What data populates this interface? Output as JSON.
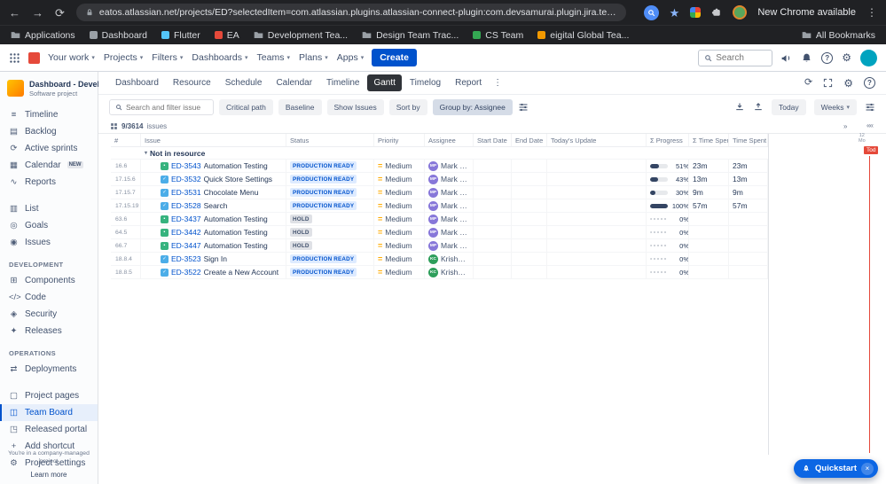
{
  "browser": {
    "url": "eatos.atlassian.net/projects/ED?selectedItem=com.atlassian.plugins.atlassian-connect-plugin:com.devsamurai.plugin.jira.team-boar...",
    "update_notice": "New Chrome available"
  },
  "bookmarks_bar": {
    "items": [
      {
        "label": "Applications",
        "icon": "folder"
      },
      {
        "label": "Dashboard",
        "icon": "favicon",
        "color": "#9aa0a6"
      },
      {
        "label": "Flutter",
        "icon": "favicon",
        "color": "#54c5f8"
      },
      {
        "label": "EA",
        "icon": "favicon",
        "color": "#e5493a"
      },
      {
        "label": "Development Tea...",
        "icon": "folder"
      },
      {
        "label": "Design Team Trac...",
        "icon": "folder"
      },
      {
        "label": "CS Team",
        "icon": "favicon",
        "color": "#34a853"
      },
      {
        "label": "eigital Global Tea...",
        "icon": "favicon",
        "color": "#f29900"
      }
    ],
    "all_bookmarks_label": "All Bookmarks"
  },
  "jira_nav": {
    "menus": [
      "Your work",
      "Projects",
      "Filters",
      "Dashboards",
      "Teams",
      "Plans",
      "Apps"
    ],
    "create_label": "Create",
    "search_placeholder": "Search"
  },
  "sidebar": {
    "project_name": "Dashboard - Develop...",
    "project_type": "Software project",
    "sections": [
      {
        "items": [
          {
            "icon": "≡",
            "label": "Timeline"
          },
          {
            "icon": "▤",
            "label": "Backlog"
          },
          {
            "icon": "⟳",
            "label": "Active sprints"
          },
          {
            "icon": "▦",
            "label": "Calendar",
            "badge": "NEW"
          },
          {
            "icon": "∿",
            "label": "Reports"
          }
        ]
      },
      {
        "items": [
          {
            "icon": "▥",
            "label": "List"
          },
          {
            "icon": "◎",
            "label": "Goals"
          },
          {
            "icon": "◉",
            "label": "Issues"
          }
        ]
      },
      {
        "title": "DEVELOPMENT",
        "items": [
          {
            "icon": "⊞",
            "label": "Components"
          },
          {
            "icon": "</>",
            "label": "Code"
          },
          {
            "icon": "◈",
            "label": "Security"
          },
          {
            "icon": "✦",
            "label": "Releases"
          }
        ]
      },
      {
        "title": "OPERATIONS",
        "items": [
          {
            "icon": "⇄",
            "label": "Deployments"
          }
        ]
      },
      {
        "items": [
          {
            "icon": "▢",
            "label": "Project pages"
          },
          {
            "icon": "◫",
            "label": "Team Board",
            "selected": true
          },
          {
            "icon": "◳",
            "label": "Released portal"
          },
          {
            "icon": "+",
            "label": "Add shortcut"
          },
          {
            "icon": "⚙",
            "label": "Project settings"
          }
        ]
      }
    ],
    "footer_note": "You're in a company-managed project",
    "learn_more_label": "Learn more"
  },
  "plugin": {
    "tabs": [
      "Dashboard",
      "Resource",
      "Schedule",
      "Calendar",
      "Timeline",
      "Gantt",
      "Timelog",
      "Report"
    ],
    "active_tab": "Gantt",
    "toolbar": {
      "search_placeholder": "Search and filter issue",
      "buttons": [
        {
          "label": "Critical path"
        },
        {
          "label": "Baseline"
        },
        {
          "label": "Show Issues"
        },
        {
          "label": "Sort by"
        },
        {
          "label": "Group by: Assignee",
          "variant": "active"
        }
      ],
      "today_label": "Today",
      "zoom_label": "Weeks"
    },
    "grid": {
      "issues_count": "9/3614",
      "issues_label": "issues",
      "columns": [
        "#",
        "Issue",
        "Status",
        "Priority",
        "Assignee",
        "Start Date",
        "End Date",
        "Today's Update",
        "Σ Progress",
        "Σ Time Spent",
        "Time Spent"
      ],
      "group_label": "Not in resource",
      "rows": [
        {
          "num": "16.6",
          "key": "ED-3543",
          "summary": "Automation Testing",
          "type": "story",
          "status": "PRODUCTION READY",
          "status_variant": "ready",
          "priority": "Medium",
          "assignee": "Mark Jo...",
          "avatar_initials": "MP",
          "avatar_color": "#8777d9",
          "progress_pct": 51,
          "progress_label": "51%",
          "sum_time_spent": "23m",
          "time_spent": "23m"
        },
        {
          "num": "17.15.6",
          "key": "ED-3532",
          "summary": "Quick Store Settings",
          "type": "task",
          "status": "PRODUCTION READY",
          "status_variant": "ready",
          "priority": "Medium",
          "assignee": "Mark Jo...",
          "avatar_initials": "MP",
          "avatar_color": "#8777d9",
          "progress_pct": 43,
          "progress_label": "43%",
          "sum_time_spent": "13m",
          "time_spent": "13m"
        },
        {
          "num": "17.15.7",
          "key": "ED-3531",
          "summary": "Chocolate Menu",
          "type": "task",
          "status": "PRODUCTION READY",
          "status_variant": "ready",
          "priority": "Medium",
          "assignee": "Mark Jo...",
          "avatar_initials": "MP",
          "avatar_color": "#8777d9",
          "progress_pct": 30,
          "progress_label": "30%",
          "sum_time_spent": "9m",
          "time_spent": "9m"
        },
        {
          "num": "17.15.19",
          "key": "ED-3528",
          "summary": "Search",
          "type": "task",
          "status": "PRODUCTION READY",
          "status_variant": "ready",
          "priority": "Medium",
          "assignee": "Mark Jo...",
          "avatar_initials": "MP",
          "avatar_color": "#8777d9",
          "progress_pct": 100,
          "progress_label": "100%",
          "sum_time_spent": "57m",
          "time_spent": "57m"
        },
        {
          "num": "63.6",
          "key": "ED-3437",
          "summary": "Automation Testing",
          "type": "story",
          "status": "HOLD",
          "status_variant": "hold",
          "priority": "Medium",
          "assignee": "Mark Jo...",
          "avatar_initials": "MP",
          "avatar_color": "#8777d9",
          "progress_pct": 0,
          "progress_label": "0%",
          "sum_time_spent": "",
          "time_spent": ""
        },
        {
          "num": "64.5",
          "key": "ED-3442",
          "summary": "Automation Testing",
          "type": "story",
          "status": "HOLD",
          "status_variant": "hold",
          "priority": "Medium",
          "assignee": "Mark Jo...",
          "avatar_initials": "MP",
          "avatar_color": "#8777d9",
          "progress_pct": 0,
          "progress_label": "0%",
          "sum_time_spent": "",
          "time_spent": ""
        },
        {
          "num": "66.7",
          "key": "ED-3447",
          "summary": "Automation Testing",
          "type": "story",
          "status": "HOLD",
          "status_variant": "hold",
          "priority": "Medium",
          "assignee": "Mark Jo...",
          "avatar_initials": "MP",
          "avatar_color": "#8777d9",
          "progress_pct": 0,
          "progress_label": "0%",
          "sum_time_spent": "",
          "time_spent": ""
        },
        {
          "num": "18.8.4",
          "key": "ED-3523",
          "summary": "Sign In",
          "type": "task",
          "status": "PRODUCTION READY",
          "status_variant": "ready",
          "priority": "Medium",
          "assignee": "Krishan ...",
          "avatar_initials": "KC",
          "avatar_color": "#2e9e5b",
          "progress_pct": 0,
          "progress_label": "0%",
          "sum_time_spent": "",
          "time_spent": ""
        },
        {
          "num": "18.8.5",
          "key": "ED-3522",
          "summary": "Create a New Account",
          "type": "task",
          "status": "PRODUCTION READY",
          "status_variant": "ready",
          "priority": "Medium",
          "assignee": "Krishan ...",
          "avatar_initials": "KC",
          "avatar_color": "#2e9e5b",
          "progress_pct": 0,
          "progress_label": "0%",
          "sum_time_spent": "",
          "time_spent": ""
        }
      ]
    },
    "timeline": {
      "today_label": "Tod",
      "scale_top": "12",
      "scale_bottom": "Mo"
    }
  },
  "quickstart_label": "Quickstart"
}
